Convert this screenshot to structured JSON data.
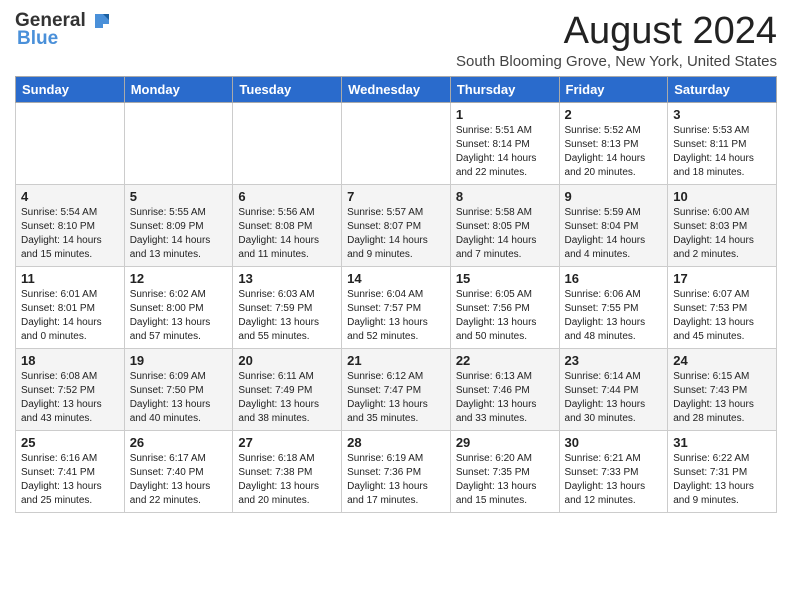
{
  "header": {
    "logo_general": "General",
    "logo_blue": "Blue",
    "month_title": "August 2024",
    "location": "South Blooming Grove, New York, United States"
  },
  "weekdays": [
    "Sunday",
    "Monday",
    "Tuesday",
    "Wednesday",
    "Thursday",
    "Friday",
    "Saturday"
  ],
  "weeks": [
    [
      {
        "day": "",
        "info": ""
      },
      {
        "day": "",
        "info": ""
      },
      {
        "day": "",
        "info": ""
      },
      {
        "day": "",
        "info": ""
      },
      {
        "day": "1",
        "info": "Sunrise: 5:51 AM\nSunset: 8:14 PM\nDaylight: 14 hours\nand 22 minutes."
      },
      {
        "day": "2",
        "info": "Sunrise: 5:52 AM\nSunset: 8:13 PM\nDaylight: 14 hours\nand 20 minutes."
      },
      {
        "day": "3",
        "info": "Sunrise: 5:53 AM\nSunset: 8:11 PM\nDaylight: 14 hours\nand 18 minutes."
      }
    ],
    [
      {
        "day": "4",
        "info": "Sunrise: 5:54 AM\nSunset: 8:10 PM\nDaylight: 14 hours\nand 15 minutes."
      },
      {
        "day": "5",
        "info": "Sunrise: 5:55 AM\nSunset: 8:09 PM\nDaylight: 14 hours\nand 13 minutes."
      },
      {
        "day": "6",
        "info": "Sunrise: 5:56 AM\nSunset: 8:08 PM\nDaylight: 14 hours\nand 11 minutes."
      },
      {
        "day": "7",
        "info": "Sunrise: 5:57 AM\nSunset: 8:07 PM\nDaylight: 14 hours\nand 9 minutes."
      },
      {
        "day": "8",
        "info": "Sunrise: 5:58 AM\nSunset: 8:05 PM\nDaylight: 14 hours\nand 7 minutes."
      },
      {
        "day": "9",
        "info": "Sunrise: 5:59 AM\nSunset: 8:04 PM\nDaylight: 14 hours\nand 4 minutes."
      },
      {
        "day": "10",
        "info": "Sunrise: 6:00 AM\nSunset: 8:03 PM\nDaylight: 14 hours\nand 2 minutes."
      }
    ],
    [
      {
        "day": "11",
        "info": "Sunrise: 6:01 AM\nSunset: 8:01 PM\nDaylight: 14 hours\nand 0 minutes."
      },
      {
        "day": "12",
        "info": "Sunrise: 6:02 AM\nSunset: 8:00 PM\nDaylight: 13 hours\nand 57 minutes."
      },
      {
        "day": "13",
        "info": "Sunrise: 6:03 AM\nSunset: 7:59 PM\nDaylight: 13 hours\nand 55 minutes."
      },
      {
        "day": "14",
        "info": "Sunrise: 6:04 AM\nSunset: 7:57 PM\nDaylight: 13 hours\nand 52 minutes."
      },
      {
        "day": "15",
        "info": "Sunrise: 6:05 AM\nSunset: 7:56 PM\nDaylight: 13 hours\nand 50 minutes."
      },
      {
        "day": "16",
        "info": "Sunrise: 6:06 AM\nSunset: 7:55 PM\nDaylight: 13 hours\nand 48 minutes."
      },
      {
        "day": "17",
        "info": "Sunrise: 6:07 AM\nSunset: 7:53 PM\nDaylight: 13 hours\nand 45 minutes."
      }
    ],
    [
      {
        "day": "18",
        "info": "Sunrise: 6:08 AM\nSunset: 7:52 PM\nDaylight: 13 hours\nand 43 minutes."
      },
      {
        "day": "19",
        "info": "Sunrise: 6:09 AM\nSunset: 7:50 PM\nDaylight: 13 hours\nand 40 minutes."
      },
      {
        "day": "20",
        "info": "Sunrise: 6:11 AM\nSunset: 7:49 PM\nDaylight: 13 hours\nand 38 minutes."
      },
      {
        "day": "21",
        "info": "Sunrise: 6:12 AM\nSunset: 7:47 PM\nDaylight: 13 hours\nand 35 minutes."
      },
      {
        "day": "22",
        "info": "Sunrise: 6:13 AM\nSunset: 7:46 PM\nDaylight: 13 hours\nand 33 minutes."
      },
      {
        "day": "23",
        "info": "Sunrise: 6:14 AM\nSunset: 7:44 PM\nDaylight: 13 hours\nand 30 minutes."
      },
      {
        "day": "24",
        "info": "Sunrise: 6:15 AM\nSunset: 7:43 PM\nDaylight: 13 hours\nand 28 minutes."
      }
    ],
    [
      {
        "day": "25",
        "info": "Sunrise: 6:16 AM\nSunset: 7:41 PM\nDaylight: 13 hours\nand 25 minutes."
      },
      {
        "day": "26",
        "info": "Sunrise: 6:17 AM\nSunset: 7:40 PM\nDaylight: 13 hours\nand 22 minutes."
      },
      {
        "day": "27",
        "info": "Sunrise: 6:18 AM\nSunset: 7:38 PM\nDaylight: 13 hours\nand 20 minutes."
      },
      {
        "day": "28",
        "info": "Sunrise: 6:19 AM\nSunset: 7:36 PM\nDaylight: 13 hours\nand 17 minutes."
      },
      {
        "day": "29",
        "info": "Sunrise: 6:20 AM\nSunset: 7:35 PM\nDaylight: 13 hours\nand 15 minutes."
      },
      {
        "day": "30",
        "info": "Sunrise: 6:21 AM\nSunset: 7:33 PM\nDaylight: 13 hours\nand 12 minutes."
      },
      {
        "day": "31",
        "info": "Sunrise: 6:22 AM\nSunset: 7:31 PM\nDaylight: 13 hours\nand 9 minutes."
      }
    ]
  ]
}
